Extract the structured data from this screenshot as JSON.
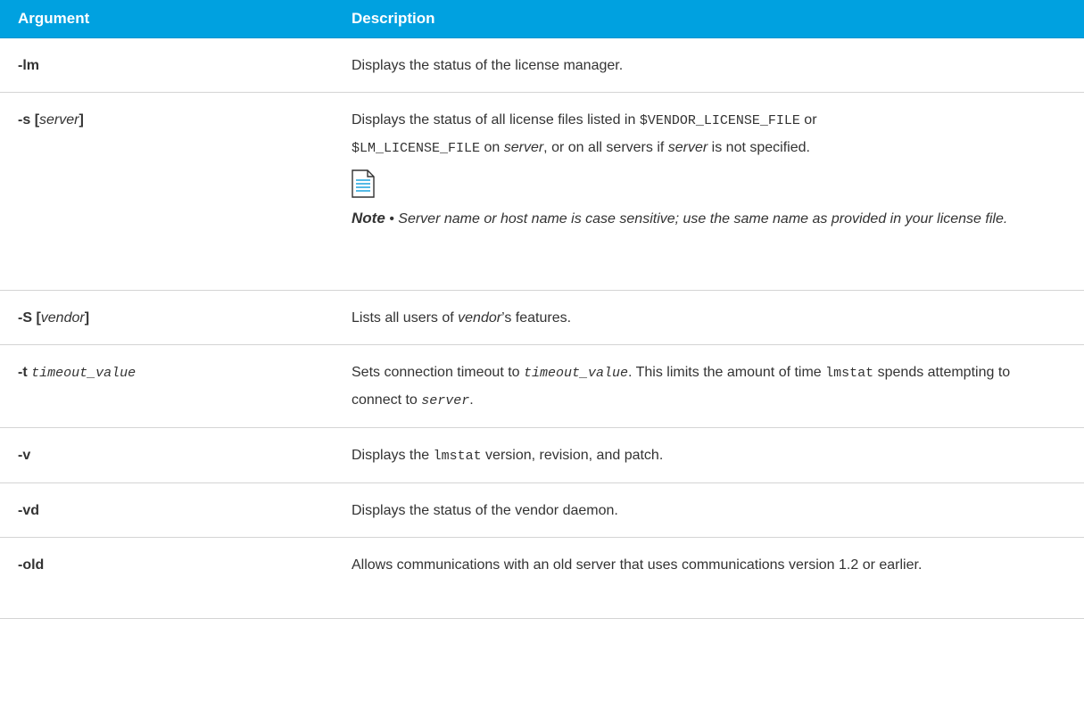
{
  "header": {
    "argument": "Argument",
    "description": "Description"
  },
  "rows": [
    {
      "flag": "-lm",
      "desc": "Displays the status of the license manager."
    },
    {
      "flag": "-s",
      "flag_open": "[",
      "param": "server",
      "flag_close": "]",
      "desc_pre": "Displays the status of all license files listed in ",
      "code1": "$VENDOR_LICENSE_FILE",
      "desc_mid1": " or ",
      "code2": "$LM_LICENSE_FILE",
      "desc_mid2": " on ",
      "param1": "server",
      "desc_mid3": ", or on all servers if ",
      "param2": "server",
      "desc_post": " is not specified.",
      "note": {
        "icon": "note-document-icon",
        "label": "Note",
        "bullet": " • ",
        "text": "Server name or host name is case sensitive; use the same name as provided in your license file."
      }
    },
    {
      "flag": "-S",
      "flag_open": "[",
      "param": "vendor",
      "flag_close": "]",
      "desc_pre": "Lists all users of ",
      "param1": "vendor",
      "desc_post": "’s features."
    },
    {
      "flag": "-t",
      "param": "timeout_value",
      "desc_pre": "Sets connection timeout to ",
      "param1": "timeout_value",
      "desc_mid1": ". This limits the amount of time ",
      "code1": "lmstat",
      "desc_mid2": " spends attempting to connect to ",
      "param2": "server",
      "desc_post": "."
    },
    {
      "flag": "-v",
      "desc_pre": "Displays the ",
      "code1": "lmstat",
      "desc_post": " version, revision, and patch."
    },
    {
      "flag": "-vd",
      "desc": "Displays the status of the vendor daemon."
    },
    {
      "flag": "-old",
      "desc": "Allows communications with an old server that uses communications version 1.2 or earlier."
    }
  ],
  "colors": {
    "header_bg": "#00a1e0",
    "header_text": "#ffffff",
    "body_text": "#333333",
    "row_border": "#d4d4d4",
    "icon_blue": "#29a8e0"
  }
}
